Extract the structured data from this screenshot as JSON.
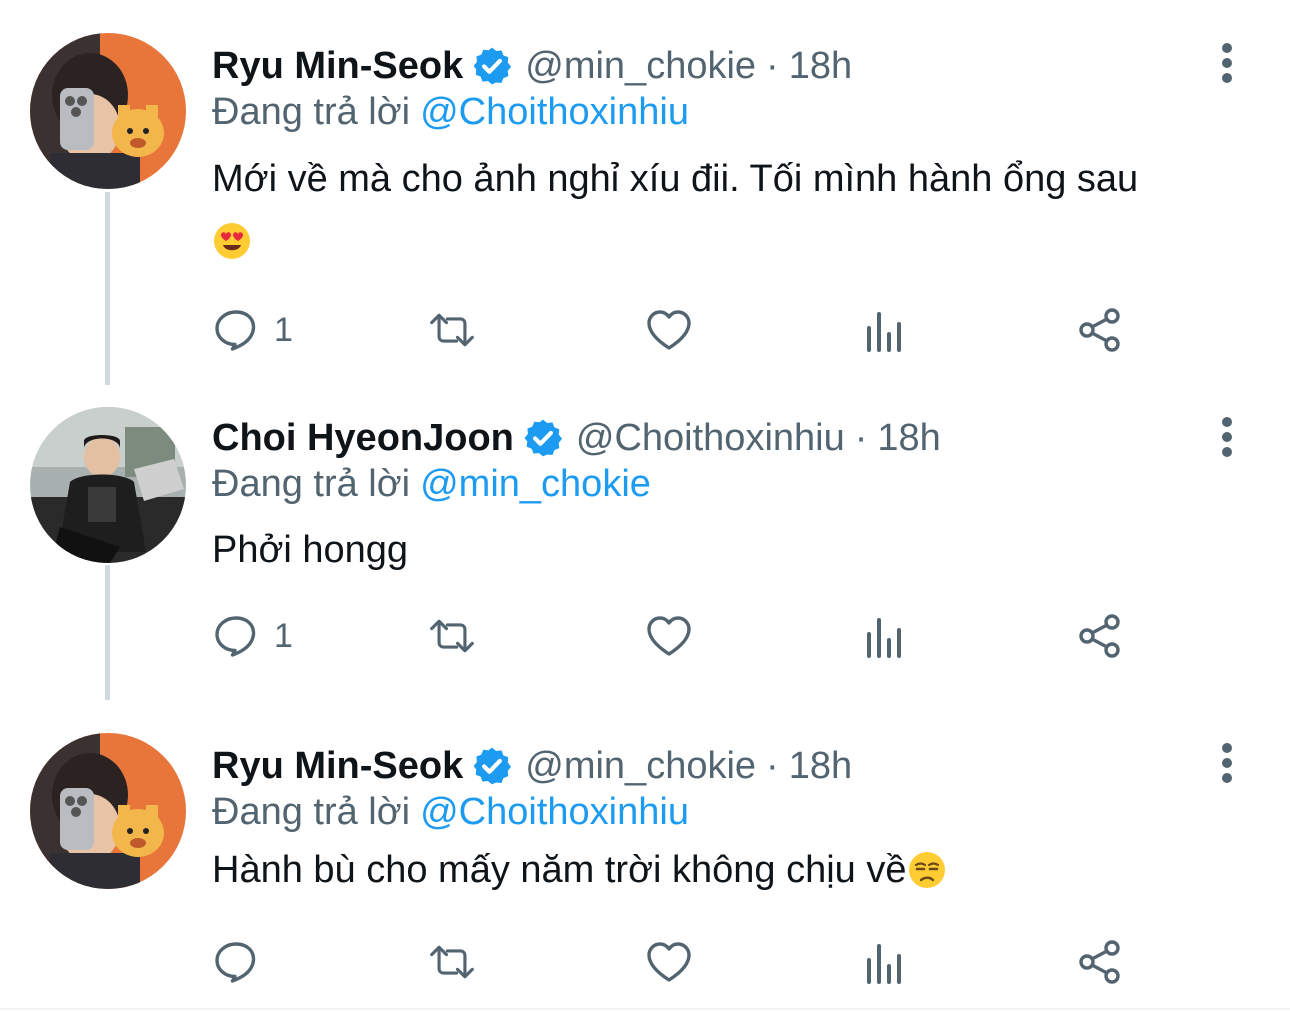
{
  "tweets": [
    {
      "display_name": "Ryu Min-Seok",
      "handle": "@min_chokie",
      "separator": "·",
      "time": "18h",
      "reply_prefix": "Đang trả lời",
      "reply_to": "@Choithoxinhiu",
      "text": "Mới về mà cho ảnh nghỉ xíu đii. Tối mình hành ổng sau",
      "emoji": "heart-eyes-emoji",
      "reply_count": "1"
    },
    {
      "display_name": "Choi HyeonJoon",
      "handle": "@Choithoxinhiu",
      "separator": "·",
      "time": "18h",
      "reply_prefix": "Đang trả lời",
      "reply_to": "@min_chokie",
      "text": "Phởi hongg",
      "reply_count": "1"
    },
    {
      "display_name": "Ryu Min-Seok",
      "handle": "@min_chokie",
      "separator": "·",
      "time": "18h",
      "reply_prefix": "Đang trả lời",
      "reply_to": "@Choithoxinhiu",
      "text": "Hành bù cho mấy năm trời không chịu về",
      "emoji": "unamused-face-emoji",
      "reply_count": ""
    }
  ],
  "icons": {
    "verified": "verified-badge-icon",
    "more": "more-options-icon",
    "reply": "reply-icon",
    "retweet": "retweet-icon",
    "like": "heart-icon",
    "views": "views-bar-chart-icon",
    "share": "share-icon"
  },
  "colors": {
    "text": "#0f1419",
    "secondary": "#536471",
    "link": "#1d9bf0",
    "thread_line": "#cfd9de"
  }
}
